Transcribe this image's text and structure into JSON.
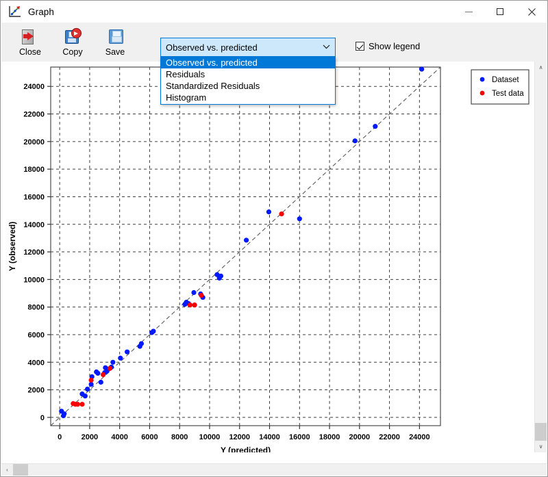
{
  "window": {
    "title": "Graph",
    "icon": "graph-icon",
    "controls": {
      "minimize": "–",
      "maximize": "□",
      "close": "✕"
    }
  },
  "toolbar": {
    "buttons": [
      {
        "label": "Close",
        "icon": "close-door-icon"
      },
      {
        "label": "Copy",
        "icon": "copy-disk-icon"
      },
      {
        "label": "Save",
        "icon": "save-floppy-icon"
      }
    ],
    "plot_select": {
      "value": "Observed vs. predicted",
      "expanded": true,
      "chevron": "⌄",
      "options": [
        "Observed vs. predicted",
        "Residuals",
        "Standardized Residuals",
        "Histogram"
      ],
      "selected_index": 0
    },
    "show_legend": {
      "label": "Show legend",
      "checked": true
    }
  },
  "scrollbars": {
    "vertical": {
      "up": "∧",
      "down": "∨"
    },
    "horizontal": {
      "left": "‹",
      "right": "›"
    }
  },
  "chart_data": {
    "type": "scatter",
    "title": "",
    "xlabel": "Y (predicted)",
    "ylabel": "Y (observed)",
    "xlim": [
      -600,
      25400
    ],
    "ylim": [
      -600,
      25400
    ],
    "xticks": [
      0,
      2000,
      4000,
      6000,
      8000,
      10000,
      12000,
      14000,
      16000,
      18000,
      20000,
      22000,
      24000
    ],
    "yticks": [
      0,
      2000,
      4000,
      6000,
      8000,
      10000,
      12000,
      14000,
      16000,
      18000,
      20000,
      22000,
      24000
    ],
    "grid": true,
    "grid_style": "dashed",
    "grid_color": "#3c3c3c",
    "reference_line": {
      "label": "y = x",
      "style": "dashed",
      "color": "#5a5a5a",
      "from": [
        -600,
        -600
      ],
      "to": [
        25400,
        25400
      ]
    },
    "legend": {
      "position": "outside-right-top",
      "entries": [
        {
          "label": "Dataset",
          "color": "#0019ff",
          "marker": "circle"
        },
        {
          "label": "Test data",
          "color": "#fb0000",
          "marker": "circle"
        }
      ]
    },
    "series": [
      {
        "name": "Dataset",
        "color": "#0019ff",
        "points": [
          [
            120,
            450
          ],
          [
            250,
            120
          ],
          [
            300,
            260
          ],
          [
            1500,
            1700
          ],
          [
            1700,
            1550
          ],
          [
            1850,
            2050
          ],
          [
            2100,
            2400
          ],
          [
            2150,
            2950
          ],
          [
            2450,
            3300
          ],
          [
            2550,
            3200
          ],
          [
            2750,
            2550
          ],
          [
            3000,
            3250
          ],
          [
            3050,
            3600
          ],
          [
            3150,
            3350
          ],
          [
            3250,
            3500
          ],
          [
            3450,
            3650
          ],
          [
            3550,
            4000
          ],
          [
            4050,
            4300
          ],
          [
            4500,
            4750
          ],
          [
            5350,
            5150
          ],
          [
            5450,
            5350
          ],
          [
            6150,
            6150
          ],
          [
            6250,
            6250
          ],
          [
            8350,
            8200
          ],
          [
            8450,
            8350
          ],
          [
            8600,
            8250
          ],
          [
            8950,
            9050
          ],
          [
            9400,
            8950
          ],
          [
            9550,
            8700
          ],
          [
            10500,
            10350
          ],
          [
            10650,
            10100
          ],
          [
            10750,
            10250
          ],
          [
            12450,
            12850
          ],
          [
            13950,
            14900
          ],
          [
            16000,
            14400
          ],
          [
            19700,
            20050
          ],
          [
            21050,
            21100
          ],
          [
            24150,
            25250
          ]
        ]
      },
      {
        "name": "Test data",
        "color": "#fb0000",
        "points": [
          [
            900,
            1000
          ],
          [
            1050,
            950
          ],
          [
            1200,
            950
          ],
          [
            1500,
            950
          ],
          [
            2100,
            2700
          ],
          [
            2900,
            3100
          ],
          [
            3350,
            3550
          ],
          [
            8700,
            8150
          ],
          [
            9000,
            8150
          ],
          [
            9450,
            8850
          ],
          [
            14800,
            14750
          ]
        ]
      }
    ]
  }
}
